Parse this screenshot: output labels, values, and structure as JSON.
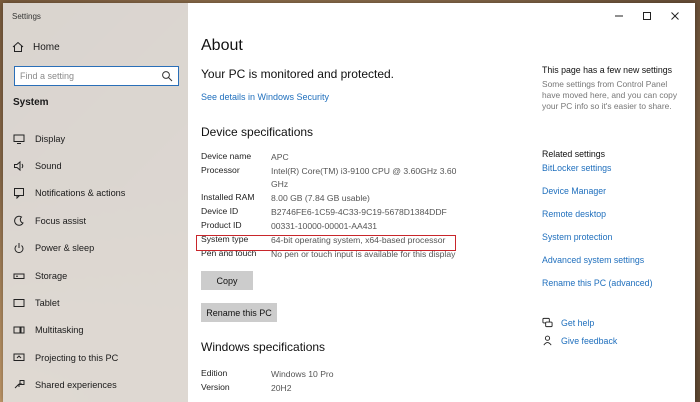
{
  "window": {
    "title": "Settings"
  },
  "sidebar": {
    "home_label": "Home",
    "search_placeholder": "Find a setting",
    "section": "System",
    "items": [
      {
        "label": "Display",
        "icon": "display-icon"
      },
      {
        "label": "Sound",
        "icon": "sound-icon"
      },
      {
        "label": "Notifications & actions",
        "icon": "notifications-icon"
      },
      {
        "label": "Focus assist",
        "icon": "focus-assist-icon"
      },
      {
        "label": "Power & sleep",
        "icon": "power-icon"
      },
      {
        "label": "Storage",
        "icon": "storage-icon"
      },
      {
        "label": "Tablet",
        "icon": "tablet-icon"
      },
      {
        "label": "Multitasking",
        "icon": "multitasking-icon"
      },
      {
        "label": "Projecting to this PC",
        "icon": "projecting-icon"
      },
      {
        "label": "Shared experiences",
        "icon": "shared-experiences-icon"
      }
    ]
  },
  "main": {
    "title": "About",
    "protected_text": "Your PC is monitored and protected.",
    "security_link": "See details in Windows Security",
    "device_specs_heading": "Device specifications",
    "device_specs": [
      {
        "key": "Device name",
        "value": "APC"
      },
      {
        "key": "Processor",
        "value": "Intel(R) Core(TM) i3-9100 CPU @ 3.60GHz   3.60 GHz"
      },
      {
        "key": "Installed RAM",
        "value": "8.00 GB (7.84 GB usable)"
      },
      {
        "key": "Device ID",
        "value": "B2746FE6-1C59-4C33-9C19-5678D1384DDF"
      },
      {
        "key": "Product ID",
        "value": "00331-10000-00001-AA431"
      },
      {
        "key": "System type",
        "value": "64-bit operating system, x64-based processor"
      },
      {
        "key": "Pen and touch",
        "value": "No pen or touch input is available for this display"
      }
    ],
    "copy_button": "Copy",
    "rename_button": "Rename this PC",
    "windows_specs_heading": "Windows specifications",
    "windows_specs": [
      {
        "key": "Edition",
        "value": "Windows 10 Pro"
      },
      {
        "key": "Version",
        "value": "20H2"
      }
    ]
  },
  "right": {
    "new_settings_title": "This page has a few new settings",
    "new_settings_body": "Some settings from Control Panel have moved here, and you can copy your PC info so it's easier to share.",
    "related_title": "Related settings",
    "related_links": [
      "BitLocker settings",
      "Device Manager",
      "Remote desktop",
      "System protection",
      "Advanced system settings",
      "Rename this PC (advanced)"
    ],
    "get_help": "Get help",
    "give_feedback": "Give feedback"
  },
  "colors": {
    "link": "#1f6fbd",
    "highlight": "#c8262b",
    "search_border": "#2a6fb8"
  }
}
